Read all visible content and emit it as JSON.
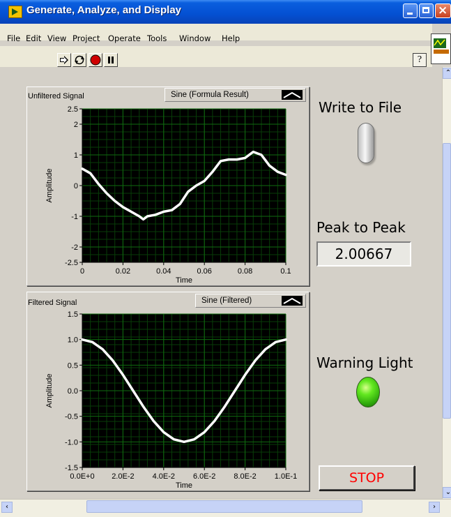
{
  "window": {
    "title": "Generate, Analyze, and Display"
  },
  "menu": [
    "File",
    "Edit",
    "View",
    "Project",
    "Operate",
    "Tools",
    "Window",
    "Help"
  ],
  "toolbar": {
    "icons": [
      "run-arrow-icon",
      "run-continuously-icon",
      "abort-icon",
      "pause-icon"
    ],
    "help_label": "?"
  },
  "graphs": {
    "unfiltered": {
      "title": "Unfiltered Signal",
      "legend": "Sine (Formula Result)",
      "ylabel": "Amplitude",
      "xlabel": "Time",
      "yticks": [
        "2.5",
        "2",
        "1",
        "0",
        "-1",
        "-2",
        "-2.5"
      ],
      "xticks": [
        "0",
        "0.02",
        "0.04",
        "0.06",
        "0.08",
        "0.1"
      ]
    },
    "filtered": {
      "title": "Filtered Signal",
      "legend": "Sine (Filtered)",
      "ylabel": "Amplitude",
      "xlabel": "Time",
      "yticks": [
        "1.5",
        "1.0",
        "0.5",
        "0.0",
        "-0.5",
        "-1.0",
        "-1.5"
      ],
      "xticks": [
        "0.0E+0",
        "2.0E-2",
        "4.0E-2",
        "6.0E-2",
        "8.0E-2",
        "1.0E-1"
      ]
    }
  },
  "controls": {
    "write_to_file_label": "Write to File",
    "write_to_file_state": "off",
    "peak_to_peak_label": "Peak to Peak",
    "peak_to_peak_value": "2.00667",
    "warning_light_label": "Warning Light",
    "warning_light_state": "on",
    "stop_label": "STOP"
  },
  "colors": {
    "plot_background": "#000000",
    "grid": "#0f6b0f",
    "trace": "#ffffff",
    "stop_text": "#ff0000",
    "led_on": "#4ed01a"
  },
  "chart_data": [
    {
      "type": "line",
      "title": "Unfiltered Signal",
      "xlabel": "Time",
      "ylabel": "Amplitude",
      "xlim": [
        0,
        0.1
      ],
      "ylim": [
        -2.5,
        2.5
      ],
      "grid": true,
      "series": [
        {
          "name": "Sine (Formula Result)",
          "x": [
            0,
            0.004,
            0.008,
            0.012,
            0.016,
            0.02,
            0.024,
            0.028,
            0.03,
            0.032,
            0.036,
            0.04,
            0.044,
            0.048,
            0.052,
            0.056,
            0.06,
            0.064,
            0.068,
            0.072,
            0.076,
            0.08,
            0.084,
            0.088,
            0.092,
            0.096,
            0.1
          ],
          "y": [
            0.55,
            0.4,
            0.05,
            -0.25,
            -0.5,
            -0.7,
            -0.85,
            -1.0,
            -1.1,
            -1.0,
            -0.95,
            -0.85,
            -0.8,
            -0.6,
            -0.2,
            0.0,
            0.15,
            0.45,
            0.8,
            0.85,
            0.85,
            0.9,
            1.1,
            1.0,
            0.65,
            0.45,
            0.35
          ]
        }
      ]
    },
    {
      "type": "line",
      "title": "Filtered Signal",
      "xlabel": "Time",
      "ylabel": "Amplitude",
      "xlim": [
        0,
        0.1
      ],
      "ylim": [
        -1.5,
        1.5
      ],
      "grid": true,
      "series": [
        {
          "name": "Sine (Filtered)",
          "x": [
            0,
            0.005,
            0.01,
            0.015,
            0.02,
            0.025,
            0.03,
            0.035,
            0.04,
            0.045,
            0.05,
            0.055,
            0.06,
            0.065,
            0.07,
            0.075,
            0.08,
            0.085,
            0.09,
            0.095,
            0.1
          ],
          "y": [
            1.0,
            0.95,
            0.81,
            0.59,
            0.31,
            0.0,
            -0.31,
            -0.59,
            -0.81,
            -0.95,
            -1.0,
            -0.95,
            -0.81,
            -0.59,
            -0.31,
            0.0,
            0.31,
            0.59,
            0.81,
            0.95,
            1.0
          ]
        }
      ]
    }
  ]
}
